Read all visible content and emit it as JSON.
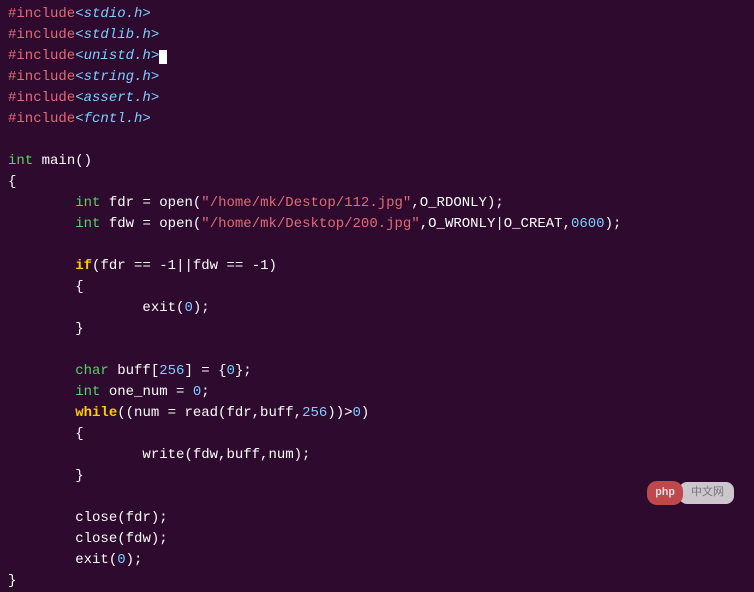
{
  "includes": [
    {
      "directive": "#include",
      "header": "<stdio.h>"
    },
    {
      "directive": "#include",
      "header": "<stdlib.h>"
    },
    {
      "directive": "#include",
      "header": "<unistd.h>"
    },
    {
      "directive": "#include",
      "header": "<string.h>"
    },
    {
      "directive": "#include",
      "header": "<assert.h>"
    },
    {
      "directive": "#include",
      "header": "<fcntl.h>"
    }
  ],
  "main_sig": {
    "ret": "int",
    "name": "main",
    "args": "()"
  },
  "fdr": {
    "type": "int",
    "name": "fdr",
    "assign": " = ",
    "func": "open",
    "path": "\"/home/mk/Destop/112.jpg\"",
    "sep": ",",
    "flag": "O_RDONLY",
    "end": ");"
  },
  "fdw": {
    "type": "int",
    "name": "fdw",
    "assign": " = ",
    "func": "open",
    "path": "\"/home/mk/Desktop/200.jpg\"",
    "sep1": ",",
    "flag": "O_WRONLY|O_CREAT",
    "sep2": ",",
    "mode": "0600",
    "end": ");"
  },
  "ifcheck": {
    "kw": "if",
    "open": "(",
    "l1": "fdr == ",
    "n1": "-1",
    "mid": "||fdw == ",
    "n2": "-1",
    "close": ")"
  },
  "exit1": {
    "func": "exit",
    "open": "(",
    "arg": "0",
    "close": ");"
  },
  "buff": {
    "type": "char",
    "name": " buff[",
    "size": "256",
    "rest": "] = {",
    "init": "0",
    "end": "};"
  },
  "onenum": {
    "type": "int",
    "name": " one_num = ",
    "val": "0",
    "end": ";"
  },
  "whileln": {
    "kw": "while",
    "open": "((num = read(fdr,buff,",
    "n": "256",
    "mid": "))>",
    "zero": "0",
    "close": ")"
  },
  "writeln": {
    "func": "write",
    "args": "(fdw,buff,num);"
  },
  "close_fdr": {
    "func": "close",
    "args": "(fdr);"
  },
  "close_fdw": {
    "func": "close",
    "args": "(fdw);"
  },
  "exit_end": {
    "func": "exit",
    "open": "(",
    "arg": "0",
    "close": ");"
  },
  "brace_open": "{",
  "brace_close": "}",
  "watermark": {
    "logo": "php",
    "text": "中文网"
  }
}
